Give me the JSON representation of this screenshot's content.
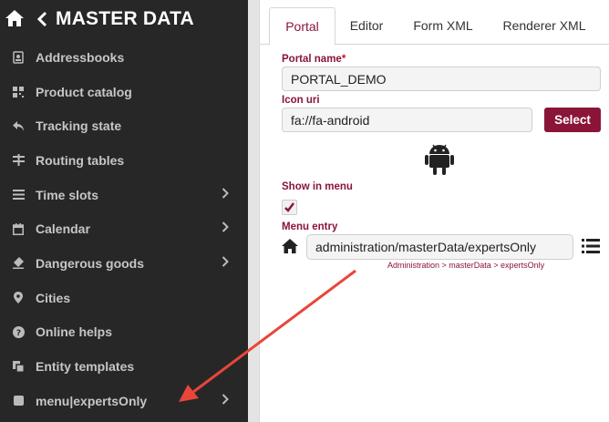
{
  "sidebar": {
    "title": "MASTER DATA",
    "items": [
      {
        "label": "Addressbooks",
        "icon": "addressbook-icon",
        "chevron": false
      },
      {
        "label": "Product catalog",
        "icon": "barcode-icon",
        "chevron": false
      },
      {
        "label": "Tracking state",
        "icon": "reply-icon",
        "chevron": false
      },
      {
        "label": "Routing tables",
        "icon": "routing-icon",
        "chevron": false
      },
      {
        "label": "Time slots",
        "icon": "list-icon",
        "chevron": true
      },
      {
        "label": "Calendar",
        "icon": "calendar-icon",
        "chevron": true
      },
      {
        "label": "Dangerous goods",
        "icon": "eraser-icon",
        "chevron": true
      },
      {
        "label": "Cities",
        "icon": "map-marker-icon",
        "chevron": false
      },
      {
        "label": "Online helps",
        "icon": "question-circle-icon",
        "chevron": false
      },
      {
        "label": "Entity templates",
        "icon": "copy-icon",
        "chevron": false
      },
      {
        "label": "menu|expertsOnly",
        "icon": "square-icon",
        "chevron": true
      }
    ]
  },
  "tabs": [
    "Portal",
    "Editor",
    "Form XML",
    "Renderer XML"
  ],
  "form": {
    "portal_name_label": "Portal name",
    "required_mark": "*",
    "portal_name_value": "PORTAL_DEMO",
    "icon_uri_label": "Icon uri",
    "icon_uri_value": "fa://fa-android",
    "select_label": "Select",
    "show_in_menu_label": "Show in menu",
    "show_in_menu_checked": true,
    "menu_entry_label": "Menu entry",
    "menu_entry_value": "administration/masterData/expertsOnly",
    "menu_entry_hint": "Administration > masterData > expertsOnly"
  },
  "colors": {
    "accent": "#8a1538",
    "sidebar_bg": "#272727",
    "arrow": "#e8463a"
  }
}
